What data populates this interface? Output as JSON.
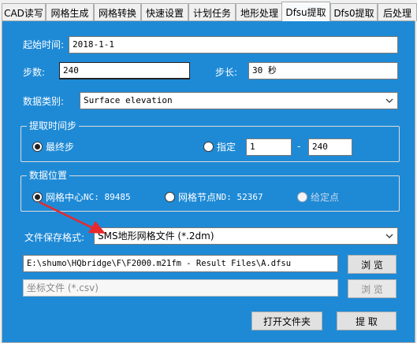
{
  "tabs": [
    {
      "label": "CAD读写"
    },
    {
      "label": "网格生成"
    },
    {
      "label": "网格转换"
    },
    {
      "label": "快速设置"
    },
    {
      "label": "计划任务"
    },
    {
      "label": "地形处理"
    },
    {
      "label": "Dfsu提取",
      "active": true
    },
    {
      "label": "Dfs0提取"
    },
    {
      "label": "后处理"
    }
  ],
  "form": {
    "start_time_label": "起始时间:",
    "start_time_value": "2018-1-1",
    "steps_label": "步数:",
    "steps_value": "240",
    "step_len_label": "步长:",
    "step_len_value": "30 秒",
    "data_type_label": "数据类别:",
    "data_type_value": "Surface elevation"
  },
  "timestep_group": {
    "title": "提取时间步",
    "last_step_label": "最终步",
    "specify_label": "指定",
    "from_value": "1",
    "dash": "-",
    "to_value": "240"
  },
  "location_group": {
    "title": "数据位置",
    "mesh_center_label": "网格中心",
    "mesh_center_info": "NC: 89485",
    "mesh_node_label": "网格节点",
    "mesh_node_info": "ND: 52367",
    "given_point_label": "给定点"
  },
  "output": {
    "format_label": "文件保存格式:",
    "format_value": "SMS地形网格文件 (*.2dm)",
    "file_path": "E:\\shumo\\HQbridge\\F\\F2000.m21fm - Result Files\\A.dfsu",
    "browse_label": "浏 览",
    "coord_placeholder": "坐标文件 (*.csv)",
    "browse2_label": "浏 览"
  },
  "actions": {
    "open_folder_label": "打开文件夹",
    "extract_label": "提 取"
  },
  "colors": {
    "panel": "#1e8ad6",
    "annotation_arrow": "#e8292b"
  }
}
